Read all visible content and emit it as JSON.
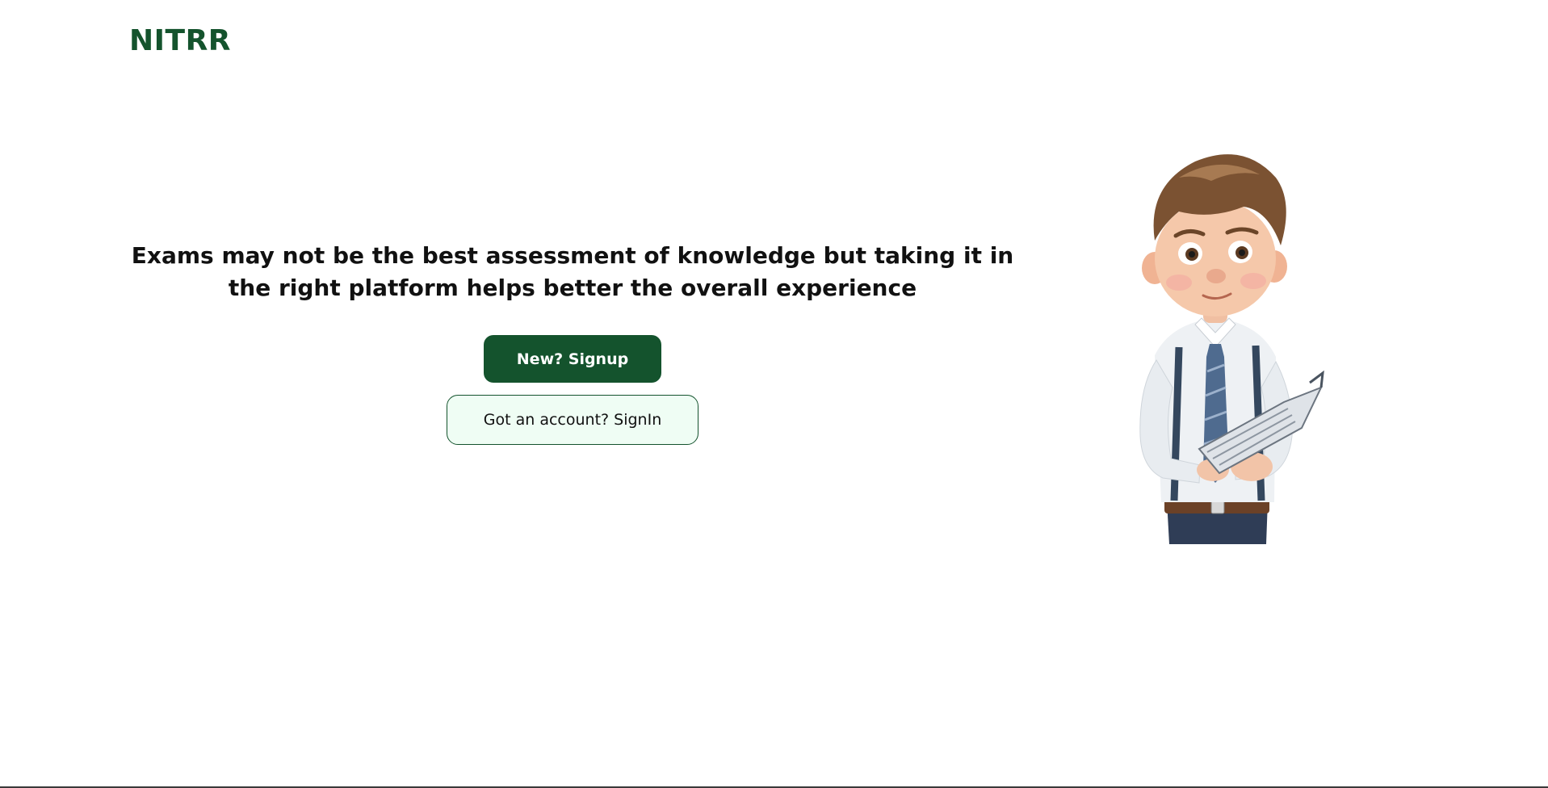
{
  "header": {
    "logo_text": "NITRR"
  },
  "hero": {
    "headline": "Exams may not be the best assessment of knowledge but taking it in the right platform helps better the overall experience",
    "signup_label": "New? Signup",
    "signin_label": "Got an account? SignIn"
  },
  "illustration": {
    "icon": "student-reading-paper-illustration"
  },
  "colors": {
    "brand": "#14532d",
    "secondary_button_bg": "#effdf4",
    "text": "#111111",
    "background": "#ffffff"
  }
}
